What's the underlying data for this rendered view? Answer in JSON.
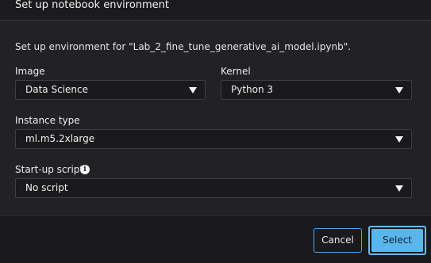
{
  "dialog": {
    "title": "Set up notebook environment",
    "description": "Set up environment for \"Lab_2_fine_tune_generative_ai_model.ipynb\"."
  },
  "fields": {
    "image": {
      "label": "Image",
      "value": "Data Science"
    },
    "kernel": {
      "label": "Kernel",
      "value": "Python 3"
    },
    "instance_type": {
      "label": "Instance type",
      "value": "ml.m5.2xlarge"
    },
    "startup_script": {
      "label": "Start-up script",
      "value": "No script"
    }
  },
  "icons": {
    "info": "info-icon",
    "dropdown": "caret-down-icon"
  },
  "footer": {
    "cancel_label": "Cancel",
    "select_label": "Select"
  },
  "colors": {
    "accent": "#5ab5ea",
    "cancel_border": "#5b9fdc",
    "background": "#222225"
  }
}
